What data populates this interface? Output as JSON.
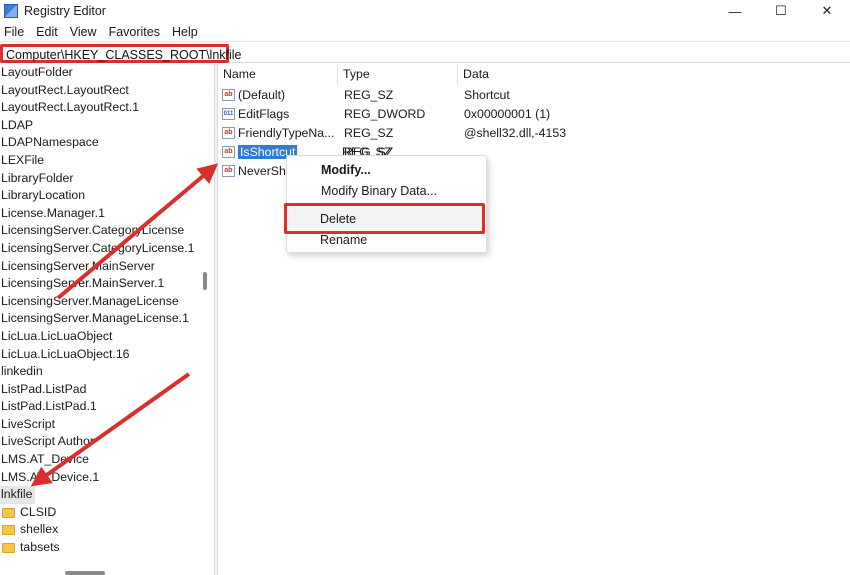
{
  "window": {
    "title": "Registry Editor",
    "minimize_label": "—",
    "maximize_label": "☐",
    "close_label": "✕"
  },
  "menu": [
    "File",
    "Edit",
    "View",
    "Favorites",
    "Help"
  ],
  "address": {
    "path": "Computer\\HKEY_CLASSES_ROOT\\lnkfile"
  },
  "tree": {
    "items": [
      "LayoutFolder",
      "LayoutRect.LayoutRect",
      "LayoutRect.LayoutRect.1",
      "LDAP",
      "LDAPNamespace",
      "LEXFile",
      "LibraryFolder",
      "LibraryLocation",
      "License.Manager.1",
      "LicensingServer.CategoryLicense",
      "LicensingServer.CategoryLicense.1",
      "LicensingServer.MainServer",
      "LicensingServer.MainServer.1",
      "LicensingServer.ManageLicense",
      "LicensingServer.ManageLicense.1",
      "LicLua.LicLuaObject",
      "LicLua.LicLuaObject.16",
      "linkedin",
      "ListPad.ListPad",
      "ListPad.ListPad.1",
      "LiveScript",
      "LiveScript Author",
      "LMS.AT_Device",
      "LMS.AT_Device.1"
    ],
    "selected": "lnkfile",
    "subfolders": [
      "CLSID",
      "shellex",
      "tabsets"
    ]
  },
  "list": {
    "columns": [
      "Name",
      "Type",
      "Data"
    ],
    "rows": [
      {
        "name": "(Default)",
        "type": "REG_SZ",
        "data": "Shortcut",
        "icon": "string-value-icon"
      },
      {
        "name": "EditFlags",
        "type": "REG_DWORD",
        "data": "0x00000001 (1)",
        "icon": "binary-value-icon"
      },
      {
        "name": "FriendlyTypeNa...",
        "type": "REG_SZ",
        "data": "@shell32.dll,-4153",
        "icon": "string-value-icon"
      },
      {
        "name": "IsShortcut",
        "type": "REG_SZ",
        "data": "",
        "icon": "string-value-icon"
      },
      {
        "name": "NeverSh",
        "type": "",
        "data": "",
        "icon": "string-value-icon"
      }
    ]
  },
  "context_menu": {
    "modify": "Modify...",
    "modify_binary": "Modify Binary Data...",
    "delete": "Delete",
    "rename": "Rename"
  },
  "colors": {
    "highlight_red": "#d92f2f",
    "selection_blue": "#2f7bd6"
  }
}
